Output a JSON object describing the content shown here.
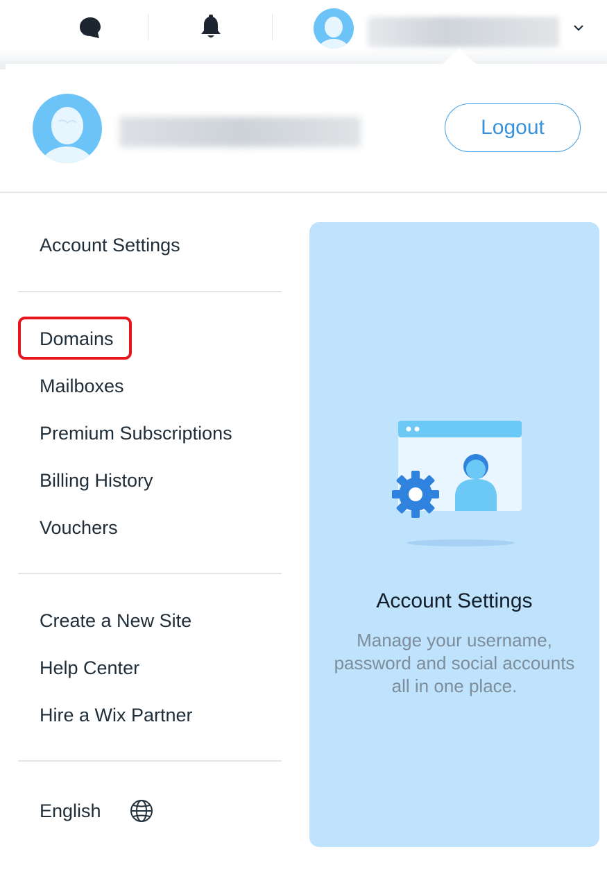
{
  "topbar": {
    "icons": [
      "chat-icon",
      "bell-icon",
      "avatar",
      "chevron-down-icon"
    ],
    "username": ""
  },
  "user_header": {
    "username": "",
    "logout_label": "Logout"
  },
  "menu": {
    "group1": [
      "Account Settings"
    ],
    "group2": [
      "Domains",
      "Mailboxes",
      "Premium Subscriptions",
      "Billing History",
      "Vouchers"
    ],
    "group3": [
      "Create a New Site",
      "Help Center",
      "Hire a Wix Partner"
    ],
    "language": "English"
  },
  "promo": {
    "title": "Account Settings",
    "description": "Manage your username, password and social accounts all in one place."
  },
  "colors": {
    "accent": "#3891dc",
    "promo_bg": "#bfe2fd",
    "highlight": "#e8141c",
    "text": "#1f2d38",
    "muted": "#7d8d99"
  }
}
